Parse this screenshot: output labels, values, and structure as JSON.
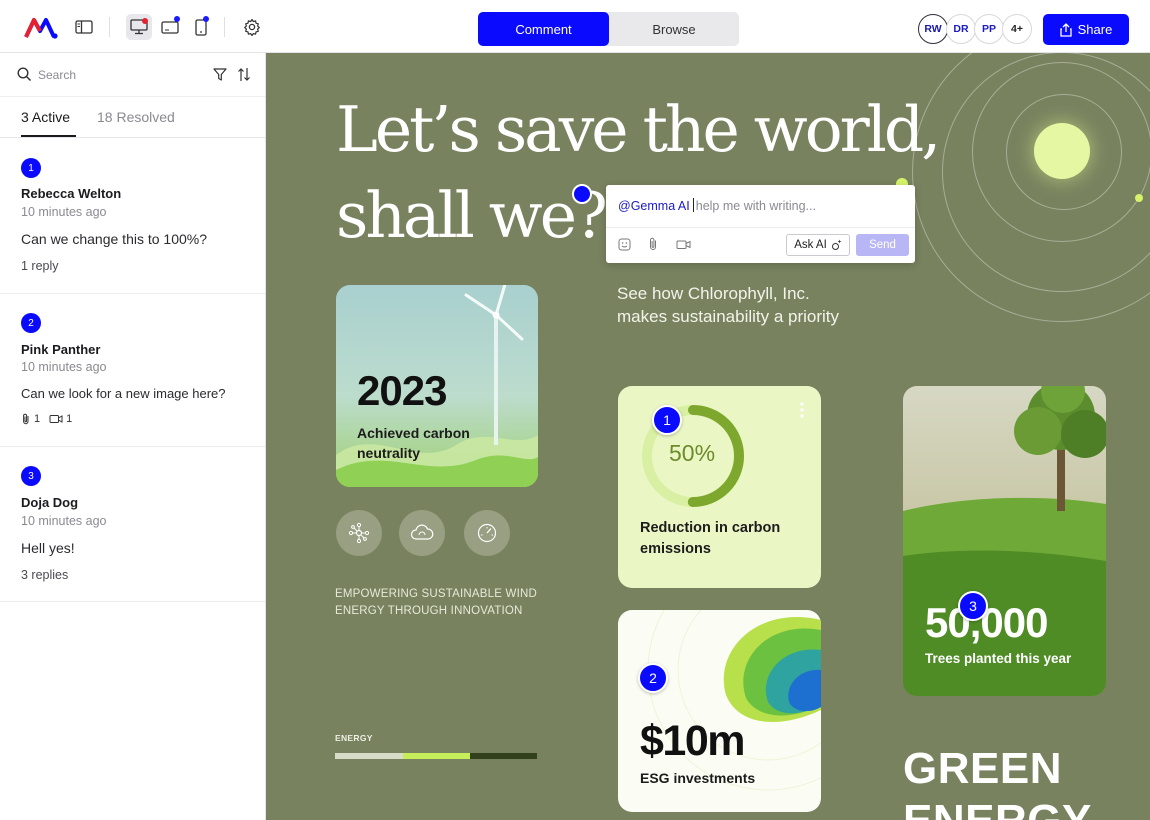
{
  "topbar": {
    "logo": "brand-logo",
    "view_icons": [
      "sidebar-panel-icon",
      "desktop-icon",
      "tablet-icon",
      "mobile-icon",
      "gear-icon"
    ],
    "mode_tabs": [
      {
        "label": "Comment",
        "active": true
      },
      {
        "label": "Browse",
        "active": false
      }
    ],
    "avatars": [
      "RW",
      "DR",
      "PP",
      "4+"
    ],
    "share_label": "Share"
  },
  "sidebar": {
    "search_placeholder": "Search",
    "tabs": [
      {
        "label": "3 Active",
        "active": true
      },
      {
        "label": "18 Resolved",
        "active": false
      }
    ],
    "comments": [
      {
        "number": "1",
        "author": "Rebecca Welton",
        "time": "10 minutes ago",
        "text": "Can we change this to 100%?",
        "replies": "1 reply"
      },
      {
        "number": "2",
        "author": "Pink Panther",
        "time": "10 minutes ago",
        "text": "Can we look for a new image here?",
        "attachments": {
          "files": "1",
          "videos": "1"
        }
      },
      {
        "number": "3",
        "author": "Doja Dog",
        "time": "10 minutes ago",
        "text": "Hell yes!",
        "replies": "3 replies"
      }
    ]
  },
  "canvas": {
    "headline_line1": "Let’s save the world,",
    "headline_line2": "shall we?",
    "subtitle_line1": "See how Chlorophyll, Inc.",
    "subtitle_line2": "makes sustainability a priority",
    "card_2023": {
      "year": "2023",
      "caption": "Achieved carbon neutrality"
    },
    "feature_icons": [
      "network-icon",
      "cloud-icon",
      "gauge-icon"
    ],
    "empower_line1": "EMPOWERING SUSTAINABLE WIND",
    "empower_line2": "ENERGY THROUGH INNOVATION",
    "energy_label": "ENERGY",
    "energy_progress": 0.67,
    "card_percent": {
      "value": "50%",
      "progress": 0.5,
      "caption": "Reduction in carbon emissions"
    },
    "card_money": {
      "value": "$10m",
      "caption": "ESG investments"
    },
    "card_trees": {
      "value": "50,000",
      "caption": "Trees planted this year"
    },
    "green_line1": "GREEN",
    "green_line2": "ENERGY",
    "pins": [
      "1",
      "2",
      "3"
    ]
  },
  "popover": {
    "mention": "@Gemma AI",
    "placeholder": "help me with writing...",
    "ask_ai_label": "Ask AI",
    "send_label": "Send"
  },
  "colors": {
    "accent": "#0a0aff",
    "canvas_bg": "#78825f",
    "lime": "#d6f36a"
  }
}
